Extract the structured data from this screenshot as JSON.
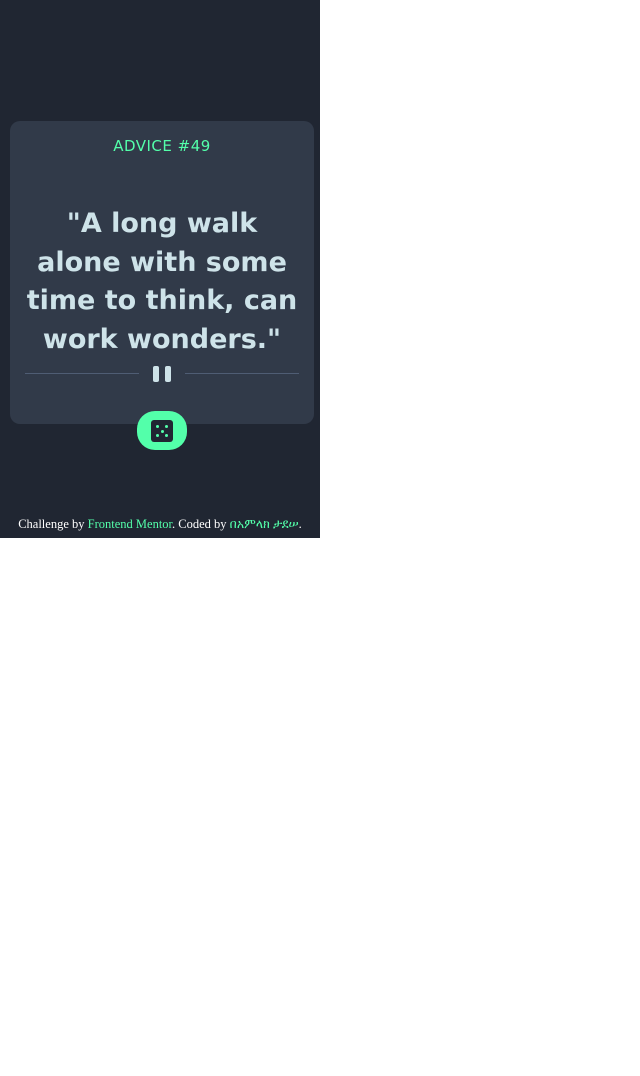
{
  "card": {
    "advice_id": "ADVICE #49",
    "quote": "\"A long walk alone with some time to think, can work wonders.\""
  },
  "divider": {
    "icon": "pause-icon"
  },
  "dice_button": {
    "icon": "dice-icon"
  },
  "footer": {
    "prefix": "Challenge by ",
    "link1": "Frontend Mentor",
    "middle": ". Coded by ",
    "link2": "በአምላክ ታደሠ",
    "suffix": "."
  },
  "colors": {
    "background": "#202632",
    "card": "#313a49",
    "accent": "#53ffaa",
    "text": "#cee3e9",
    "divider": "#4f5d74"
  }
}
